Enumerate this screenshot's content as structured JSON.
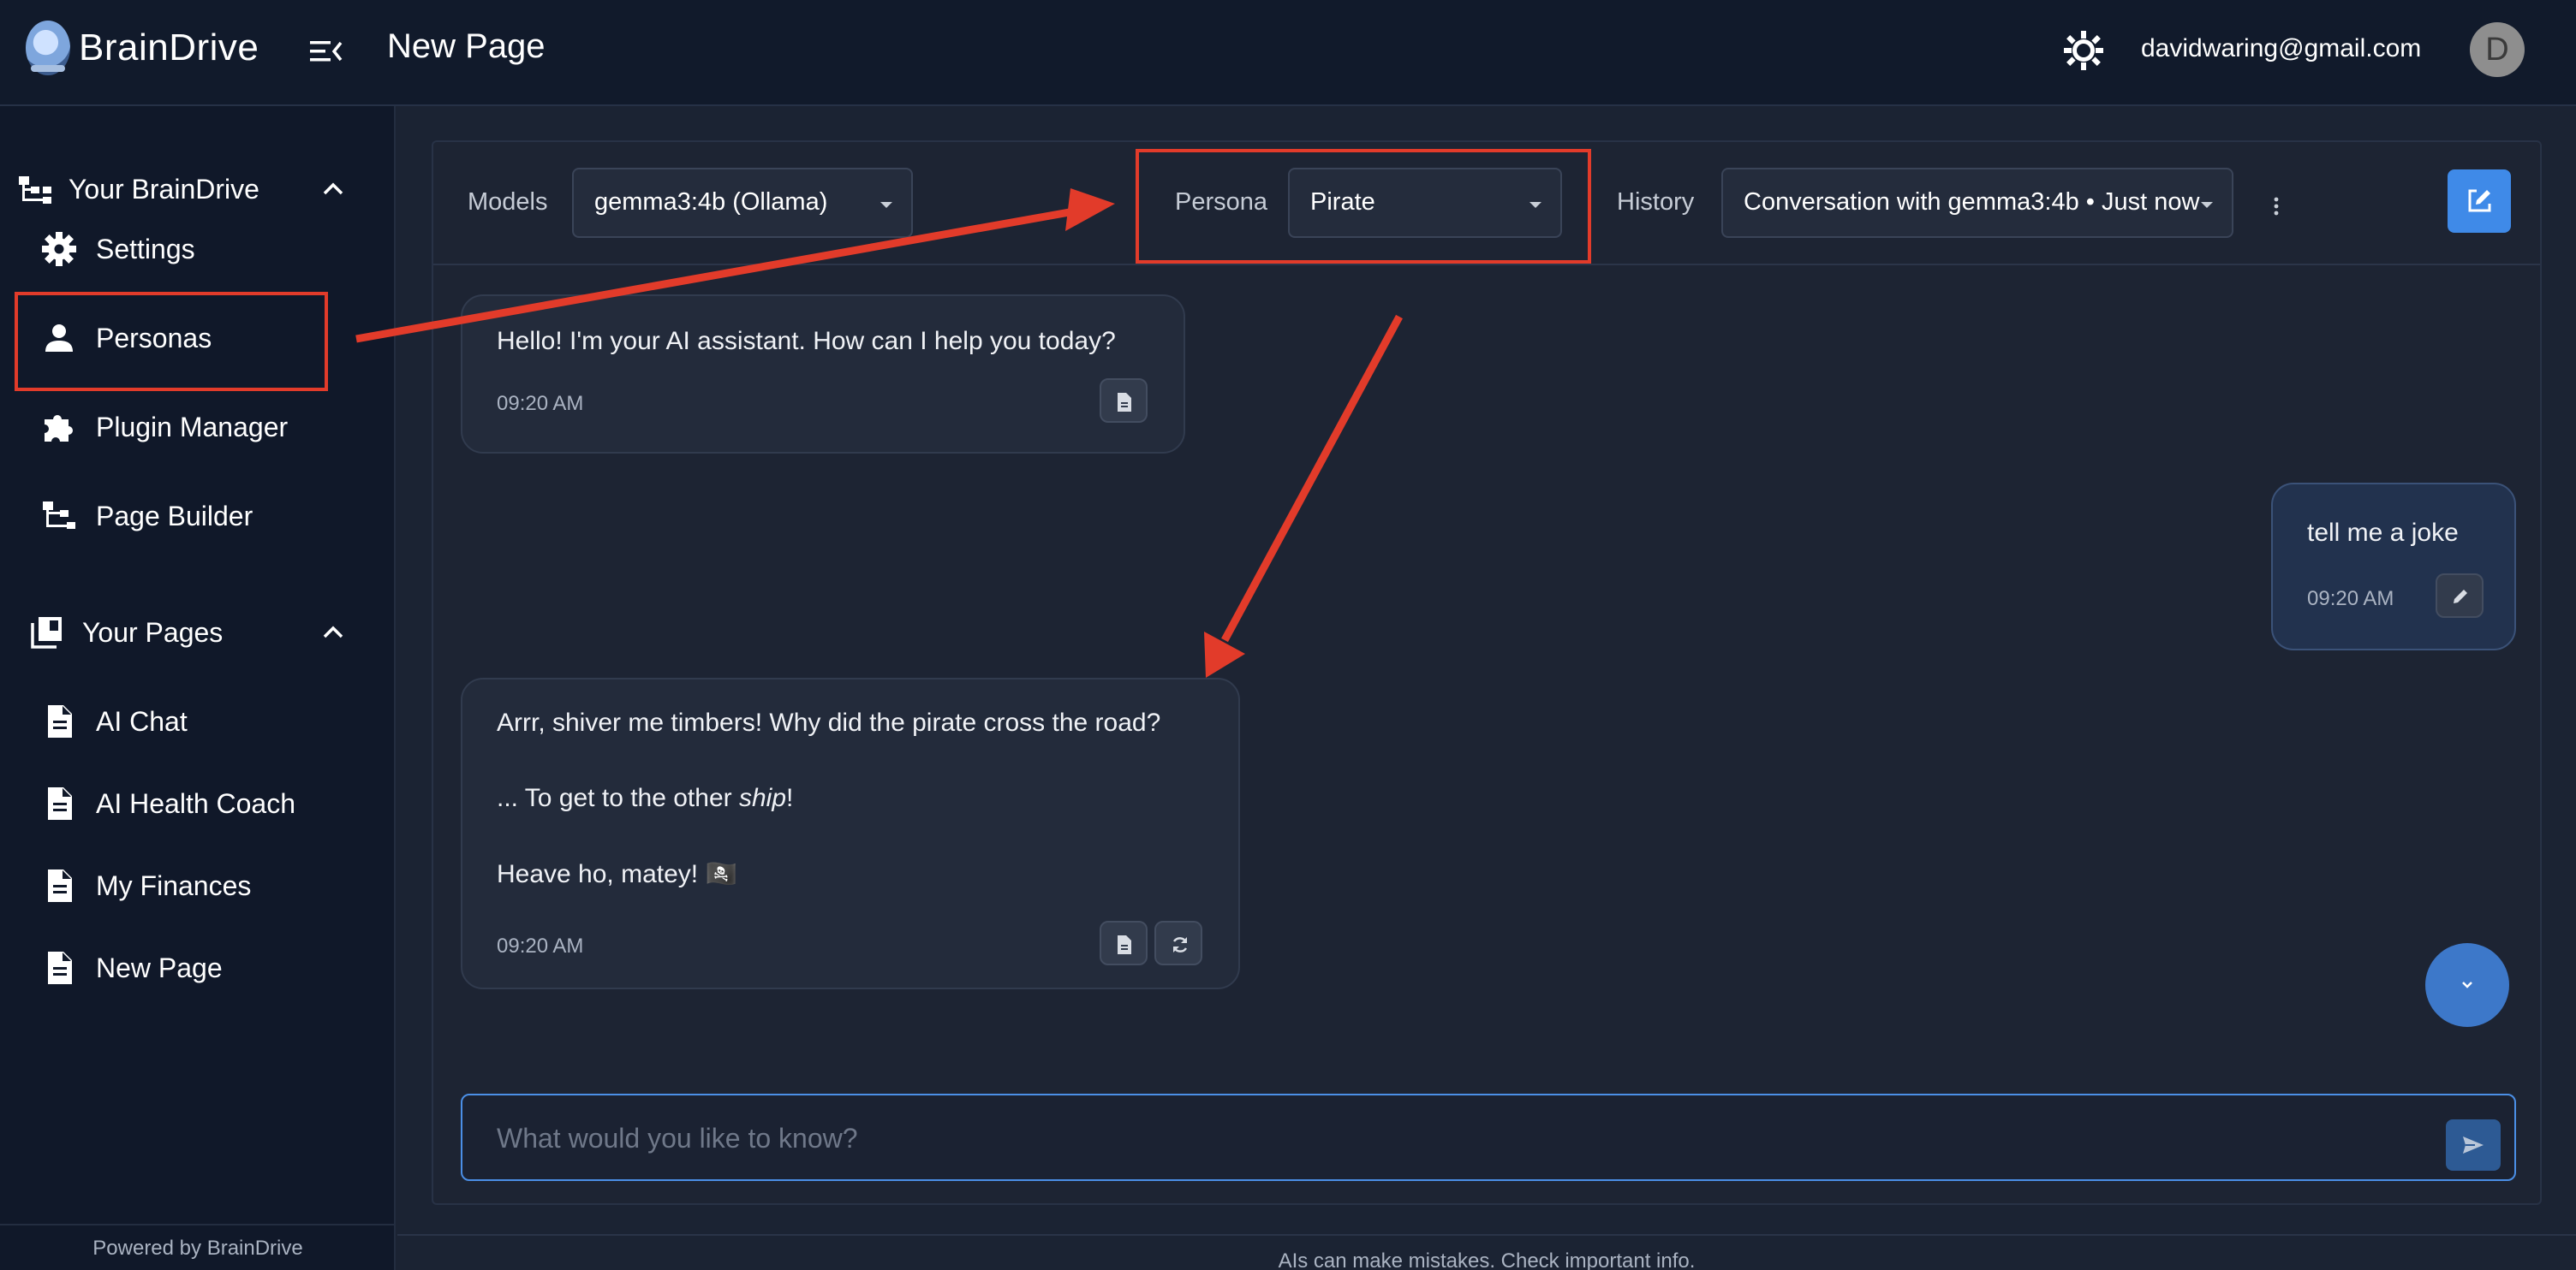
{
  "header": {
    "brand": "BrainDrive",
    "page_title": "New Page",
    "user_email": "davidwaring@gmail.com",
    "avatar_initial": "D"
  },
  "sidebar": {
    "sections": [
      {
        "label": "Your BrainDrive",
        "items": [
          {
            "label": "Settings",
            "icon": "gear-icon"
          },
          {
            "label": "Personas",
            "icon": "person-icon"
          },
          {
            "label": "Plugin Manager",
            "icon": "puzzle-icon"
          },
          {
            "label": "Page Builder",
            "icon": "sitemap-icon"
          }
        ]
      },
      {
        "label": "Your Pages",
        "items": [
          {
            "label": "AI Chat",
            "icon": "document-icon"
          },
          {
            "label": "AI Health Coach",
            "icon": "document-icon"
          },
          {
            "label": "My Finances",
            "icon": "document-icon"
          },
          {
            "label": "New Page",
            "icon": "document-icon"
          }
        ]
      }
    ],
    "footer": "Powered by BrainDrive"
  },
  "toolbar": {
    "models_label": "Models",
    "models_value": "gemma3:4b (Ollama)",
    "persona_label": "Persona",
    "persona_value": "Pirate",
    "history_label": "History",
    "history_value": "Conversation with gemma3:4b • Just now"
  },
  "messages": [
    {
      "role": "assistant",
      "lines": [
        "Hello! I'm your AI assistant. How can I help you today?"
      ],
      "time": "09:20 AM"
    },
    {
      "role": "user",
      "lines": [
        "tell me a joke"
      ],
      "time": "09:20 AM"
    },
    {
      "role": "assistant",
      "lines": [
        "Arrr, shiver me timbers! Why did the pirate cross the road?",
        "... To get to the other ",
        "ship",
        "!",
        "Heave ho, matey! 🏴‍☠️"
      ],
      "time": "09:20 AM"
    }
  ],
  "composer": {
    "placeholder": "What would you like to know?"
  },
  "footer_note": "AIs can make mistakes. Check important info.",
  "colors": {
    "background": "#1b2333",
    "sidebar": "#101829",
    "accent": "#3f8ae8",
    "annotation": "#e23b2a"
  }
}
